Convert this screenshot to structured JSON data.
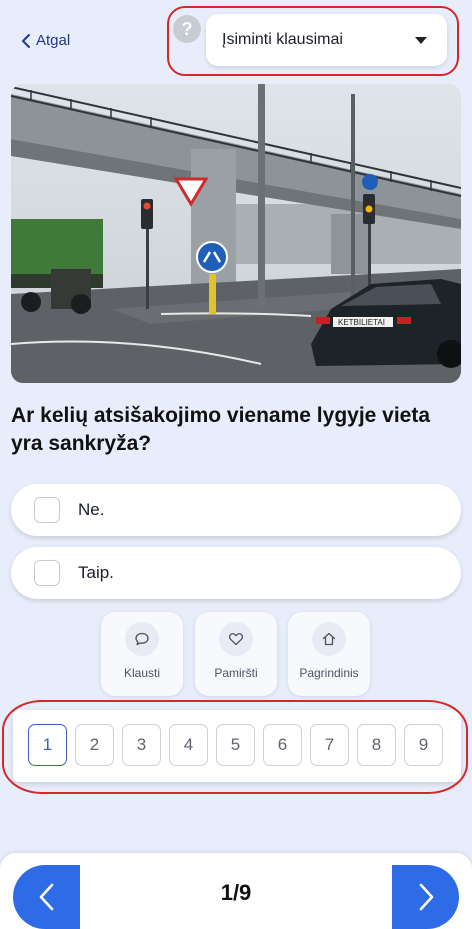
{
  "header": {
    "back_label": "Atgal",
    "help_symbol": "?",
    "dropdown_value": "Įsiminti klausimai"
  },
  "photo": {
    "plate_text": "KETBILIETAI"
  },
  "question": {
    "text": "Ar kelių atsišakojimo viename lygyje vieta yra sankryža?"
  },
  "answers": [
    {
      "label": "Ne."
    },
    {
      "label": "Taip."
    }
  ],
  "actions": [
    {
      "label": "Klausti",
      "icon": "chat-bubble-icon"
    },
    {
      "label": "Pamiršti",
      "icon": "heart-icon"
    },
    {
      "label": "Pagrindinis",
      "icon": "home-icon"
    }
  ],
  "pages": {
    "items": [
      "1",
      "2",
      "3",
      "4",
      "5",
      "6",
      "7",
      "8",
      "9"
    ],
    "active": "1"
  },
  "footer": {
    "counter": "1/9"
  },
  "colors": {
    "accent": "#2e6be6",
    "highlight_ring": "#d62828",
    "background": "#e8edfb"
  }
}
